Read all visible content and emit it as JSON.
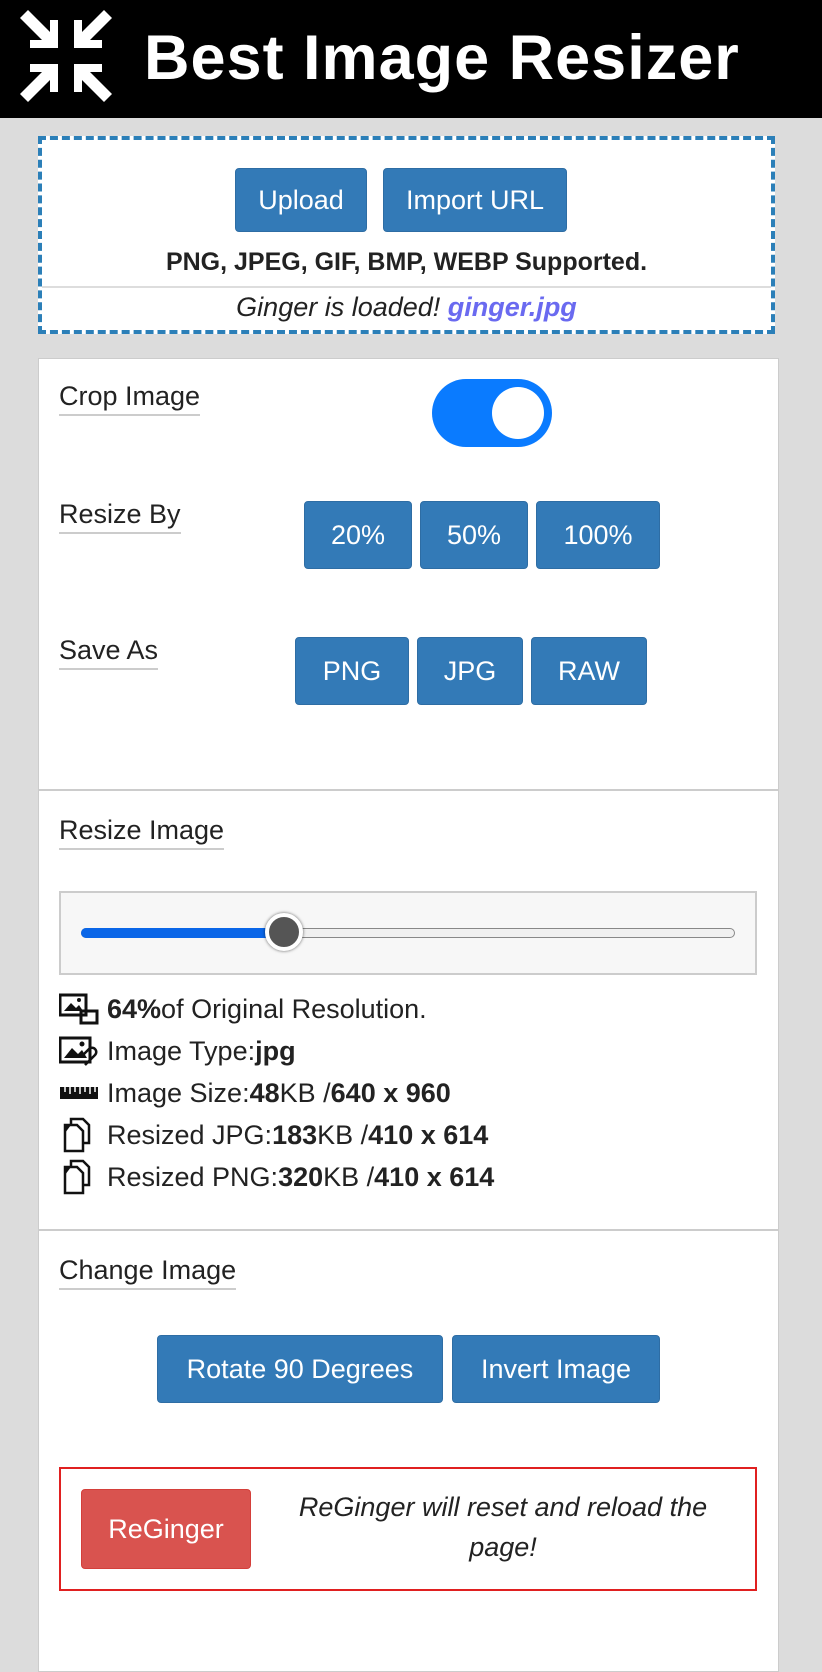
{
  "header": {
    "title": "Best Image Resizer",
    "logo_icon": "compress-arrows-icon"
  },
  "upload": {
    "upload_label": "Upload",
    "import_label": "Import URL",
    "supported_text": "PNG, JPEG, GIF, BMP, WEBP Supported.",
    "loaded_text": "Ginger is loaded! ",
    "file_name": "ginger.jpg"
  },
  "crop": {
    "label": "Crop Image",
    "enabled": true
  },
  "resize_by": {
    "label": "Resize By",
    "options": [
      "20%",
      "50%",
      "100%"
    ]
  },
  "save_as": {
    "label": "Save As",
    "options": [
      "PNG",
      "JPG",
      "RAW"
    ]
  },
  "resize_image": {
    "label": "Resize Image",
    "slider_value_percent": 64
  },
  "info": {
    "resolution_pct": "64%",
    "resolution_suffix": " of Original Resolution.",
    "type_label": "Image Type: ",
    "type_value": "jpg",
    "size_label": "Image Size: ",
    "size_kb": "48",
    "size_unit": " KB / ",
    "size_dims": "640 x 960",
    "jpg_label": "Resized JPG: ",
    "jpg_kb": "183",
    "jpg_unit": " KB / ",
    "jpg_dims": "410 x 614",
    "png_label": "Resized PNG: ",
    "png_kb": "320",
    "png_unit": " KB / ",
    "png_dims": "410 x 614"
  },
  "change_image": {
    "label": "Change Image",
    "rotate_label": "Rotate 90 Degrees",
    "invert_label": "Invert Image"
  },
  "reset": {
    "button_label": "ReGinger",
    "note": "ReGinger will reset and reload the page!"
  },
  "colors": {
    "primary": "#337ab7",
    "toggle": "#0a7bff",
    "danger": "#d9534f",
    "link": "#6a6af0"
  }
}
